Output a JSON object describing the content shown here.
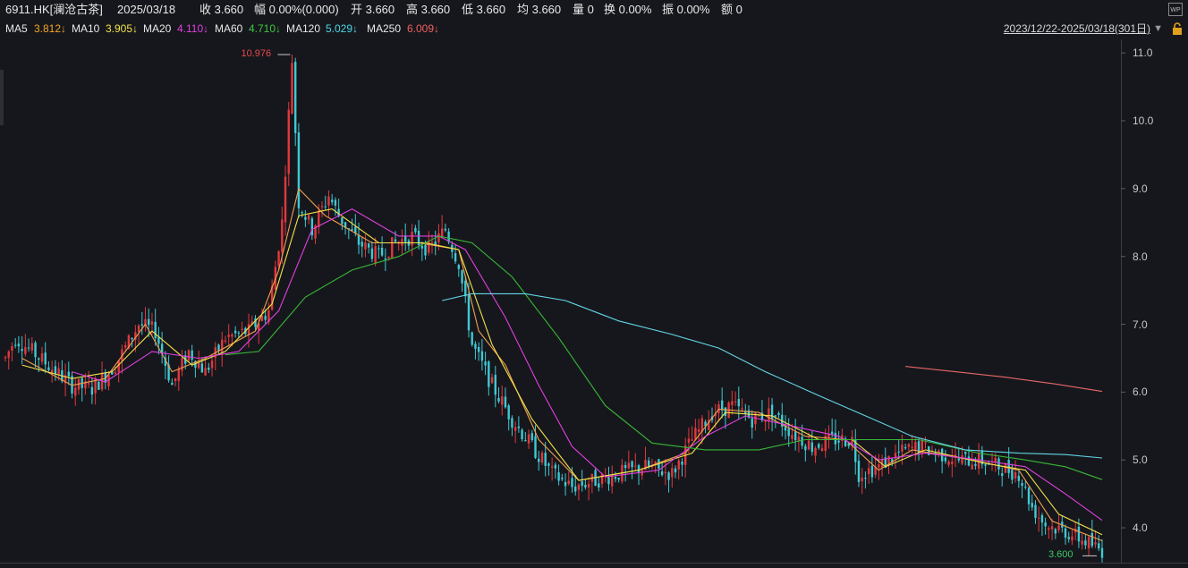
{
  "header": {
    "symbol": "6911.HK[澜沧古茶]",
    "date": "2025/03/18",
    "close": "收 3.660",
    "change": "幅 0.00%(0.000)",
    "open": "开 3.660",
    "high": "高 3.660",
    "low": "低 3.660",
    "avg": "均 3.660",
    "volume": "量 0",
    "turnover": "换 0.00%",
    "amplitude": "振 0.00%",
    "amount": "额 0"
  },
  "ma_legend": [
    {
      "label": "MA5",
      "value": "3.812↓",
      "color": "#f0f0f0",
      "value_color": "#f5a623"
    },
    {
      "label": "MA10",
      "value": "3.905↓",
      "color": "#f0f0f0",
      "value_color": "#f2e34a"
    },
    {
      "label": "MA20",
      "value": "4.110↓",
      "color": "#f0f0f0",
      "value_color": "#e040e0"
    },
    {
      "label": "MA60",
      "value": "4.710↓",
      "color": "#f0f0f0",
      "value_color": "#3cc83c"
    },
    {
      "label": "MA120",
      "value": "5.029↓",
      "color": "#f0f0f0",
      "value_color": "#4dd8e8"
    },
    {
      "label": "MA250",
      "value": "6.009↓",
      "color": "#f0f0f0",
      "value_color": "#f06060"
    }
  ],
  "range_label": "2023/12/22-2025/03/18(301日)",
  "range_arrow": "▼",
  "icons": {
    "wp": "WP",
    "lock": "lock-icon"
  },
  "max_label": "10.976",
  "min_label": "3.600",
  "colors": {
    "up": "#e0393e",
    "down": "#3fc9d4",
    "ma5": "#f0a050",
    "ma10": "#f2e34a",
    "ma20": "#e040e0",
    "ma60": "#38b838",
    "ma120": "#62d6e8",
    "ma250": "#e86868"
  },
  "chart_data": {
    "type": "candlestick",
    "period": "2023/12/22-2025/03/18",
    "ylim": [
      3.5,
      11.2
    ],
    "yticks": [
      4.0,
      5.0,
      6.0,
      7.0,
      8.0,
      9.0,
      10.0,
      11.0
    ],
    "ytick_labels": [
      "4.0",
      "5.0",
      "6.0",
      "7.0",
      "8.0",
      "9.0",
      "10.0",
      "11.0"
    ],
    "price_path": [
      [
        0,
        6.5
      ],
      [
        3,
        6.8
      ],
      [
        8,
        6.6
      ],
      [
        14,
        6.35
      ],
      [
        20,
        6.1
      ],
      [
        26,
        6.05
      ],
      [
        33,
        6.4
      ],
      [
        40,
        7.0
      ],
      [
        45,
        6.9
      ],
      [
        50,
        6.1
      ],
      [
        55,
        6.6
      ],
      [
        60,
        6.3
      ],
      [
        66,
        6.8
      ],
      [
        73,
        6.9
      ],
      [
        79,
        7.2
      ],
      [
        83,
        8.5
      ],
      [
        86,
        10.9
      ],
      [
        88,
        8.8
      ],
      [
        92,
        8.4
      ],
      [
        97,
        8.9
      ],
      [
        100,
        8.6
      ],
      [
        106,
        8.2
      ],
      [
        112,
        8.0
      ],
      [
        117,
        8.2
      ],
      [
        122,
        8.3
      ],
      [
        127,
        8.1
      ],
      [
        132,
        8.4
      ],
      [
        136,
        7.9
      ],
      [
        140,
        6.7
      ],
      [
        146,
        6.1
      ],
      [
        152,
        5.6
      ],
      [
        158,
        5.2
      ],
      [
        164,
        4.8
      ],
      [
        170,
        4.6
      ],
      [
        177,
        4.7
      ],
      [
        184,
        4.8
      ],
      [
        192,
        4.9
      ],
      [
        200,
        4.8
      ],
      [
        206,
        5.3
      ],
      [
        212,
        5.7
      ],
      [
        218,
        5.8
      ],
      [
        224,
        5.6
      ],
      [
        230,
        5.7
      ],
      [
        236,
        5.4
      ],
      [
        242,
        5.2
      ],
      [
        248,
        5.3
      ],
      [
        254,
        5.3
      ],
      [
        256,
        4.8
      ],
      [
        262,
        4.9
      ],
      [
        268,
        5.1
      ],
      [
        274,
        5.2
      ],
      [
        280,
        5.1
      ],
      [
        286,
        5.0
      ],
      [
        292,
        5.0
      ],
      [
        298,
        4.9
      ],
      [
        304,
        4.8
      ],
      [
        308,
        4.3
      ],
      [
        312,
        4.05
      ],
      [
        318,
        3.95
      ],
      [
        324,
        3.8
      ],
      [
        329,
        3.66
      ]
    ],
    "ma_paths": {
      "MA5": [
        [
          5,
          6.5
        ],
        [
          20,
          6.1
        ],
        [
          30,
          6.2
        ],
        [
          42,
          7.0
        ],
        [
          50,
          6.3
        ],
        [
          60,
          6.5
        ],
        [
          75,
          6.9
        ],
        [
          82,
          7.8
        ],
        [
          88,
          9.0
        ],
        [
          96,
          8.6
        ],
        [
          110,
          8.2
        ],
        [
          124,
          8.2
        ],
        [
          136,
          8.1
        ],
        [
          142,
          6.9
        ],
        [
          150,
          6.4
        ],
        [
          160,
          5.3
        ],
        [
          172,
          4.7
        ],
        [
          190,
          4.85
        ],
        [
          204,
          5.1
        ],
        [
          214,
          5.75
        ],
        [
          226,
          5.7
        ],
        [
          240,
          5.35
        ],
        [
          252,
          5.3
        ],
        [
          262,
          4.85
        ],
        [
          272,
          5.15
        ],
        [
          290,
          5.0
        ],
        [
          304,
          4.85
        ],
        [
          314,
          4.1
        ],
        [
          329,
          3.81
        ]
      ],
      "MA10": [
        [
          5,
          6.4
        ],
        [
          20,
          6.2
        ],
        [
          32,
          6.3
        ],
        [
          44,
          6.9
        ],
        [
          56,
          6.4
        ],
        [
          66,
          6.6
        ],
        [
          80,
          7.3
        ],
        [
          88,
          8.6
        ],
        [
          98,
          8.7
        ],
        [
          112,
          8.2
        ],
        [
          126,
          8.2
        ],
        [
          136,
          8.1
        ],
        [
          146,
          6.7
        ],
        [
          158,
          5.6
        ],
        [
          172,
          4.7
        ],
        [
          190,
          4.85
        ],
        [
          206,
          5.1
        ],
        [
          216,
          5.7
        ],
        [
          230,
          5.65
        ],
        [
          244,
          5.3
        ],
        [
          254,
          5.3
        ],
        [
          264,
          4.9
        ],
        [
          276,
          5.15
        ],
        [
          294,
          4.95
        ],
        [
          306,
          4.85
        ],
        [
          316,
          4.2
        ],
        [
          329,
          3.9
        ]
      ],
      "MA20": [
        [
          20,
          6.3
        ],
        [
          30,
          6.15
        ],
        [
          44,
          6.6
        ],
        [
          58,
          6.5
        ],
        [
          70,
          6.6
        ],
        [
          82,
          7.2
        ],
        [
          92,
          8.4
        ],
        [
          104,
          8.7
        ],
        [
          118,
          8.3
        ],
        [
          130,
          8.3
        ],
        [
          138,
          8.1
        ],
        [
          150,
          7.1
        ],
        [
          160,
          6.1
        ],
        [
          170,
          5.2
        ],
        [
          180,
          4.75
        ],
        [
          196,
          4.85
        ],
        [
          210,
          5.35
        ],
        [
          222,
          5.65
        ],
        [
          236,
          5.5
        ],
        [
          250,
          5.35
        ],
        [
          262,
          5.0
        ],
        [
          276,
          5.1
        ],
        [
          292,
          5.0
        ],
        [
          306,
          4.9
        ],
        [
          318,
          4.5
        ],
        [
          329,
          4.11
        ]
      ],
      "MA60": [
        [
          66,
          6.55
        ],
        [
          76,
          6.6
        ],
        [
          90,
          7.4
        ],
        [
          104,
          7.8
        ],
        [
          118,
          8.0
        ],
        [
          130,
          8.3
        ],
        [
          140,
          8.2
        ],
        [
          152,
          7.7
        ],
        [
          166,
          6.8
        ],
        [
          180,
          5.8
        ],
        [
          194,
          5.25
        ],
        [
          210,
          5.15
        ],
        [
          226,
          5.15
        ],
        [
          240,
          5.3
        ],
        [
          256,
          5.3
        ],
        [
          274,
          5.3
        ],
        [
          292,
          5.1
        ],
        [
          306,
          5.0
        ],
        [
          318,
          4.9
        ],
        [
          329,
          4.71
        ]
      ],
      "MA120": [
        [
          131,
          7.35
        ],
        [
          140,
          7.45
        ],
        [
          156,
          7.45
        ],
        [
          168,
          7.35
        ],
        [
          184,
          7.05
        ],
        [
          200,
          6.85
        ],
        [
          214,
          6.65
        ],
        [
          228,
          6.3
        ],
        [
          244,
          5.95
        ],
        [
          258,
          5.65
        ],
        [
          272,
          5.35
        ],
        [
          288,
          5.15
        ],
        [
          304,
          5.1
        ],
        [
          318,
          5.08
        ],
        [
          329,
          5.03
        ]
      ],
      "MA250": [
        [
          270,
          6.38
        ],
        [
          285,
          6.3
        ],
        [
          300,
          6.22
        ],
        [
          315,
          6.12
        ],
        [
          329,
          6.01
        ]
      ]
    },
    "xrange": [
      0,
      329
    ]
  }
}
